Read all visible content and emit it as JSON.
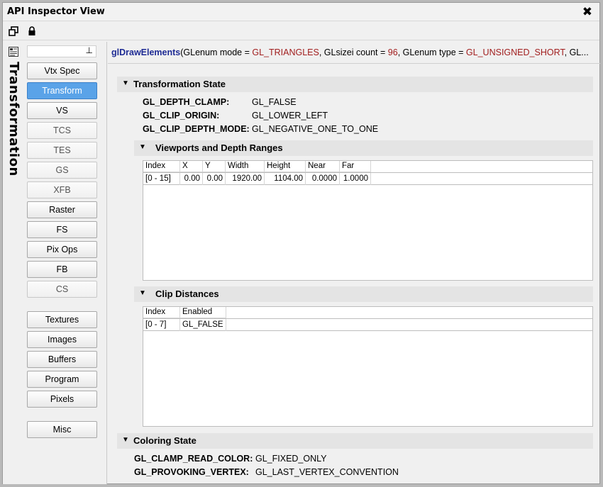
{
  "window": {
    "title": "API Inspector View"
  },
  "sidebar": {
    "vertical_title": "Transformation",
    "search_value": "",
    "stages": [
      {
        "label": "Vtx Spec",
        "state": "normal"
      },
      {
        "label": "Transform",
        "state": "active"
      },
      {
        "label": "VS",
        "state": "normal"
      },
      {
        "label": "TCS",
        "state": "dim"
      },
      {
        "label": "TES",
        "state": "dim"
      },
      {
        "label": "GS",
        "state": "dim"
      },
      {
        "label": "XFB",
        "state": "dim"
      },
      {
        "label": "Raster",
        "state": "normal"
      },
      {
        "label": "FS",
        "state": "normal"
      },
      {
        "label": "Pix Ops",
        "state": "normal"
      },
      {
        "label": "FB",
        "state": "normal"
      },
      {
        "label": "CS",
        "state": "dim"
      }
    ],
    "resources": [
      {
        "label": "Textures"
      },
      {
        "label": "Images"
      },
      {
        "label": "Buffers"
      },
      {
        "label": "Program"
      },
      {
        "label": "Pixels"
      }
    ],
    "misc": {
      "label": "Misc"
    }
  },
  "call": {
    "fn": "glDrawElements",
    "p1": "(GLenum mode = ",
    "v1": "GL_TRIANGLES",
    "p2": ", GLsizei count = ",
    "v2": "96",
    "p3": ", GLenum type = ",
    "v3": "GL_UNSIGNED_SHORT",
    "p4": ", GL..."
  },
  "transformation": {
    "title": "Transformation State",
    "props": [
      {
        "key": "GL_DEPTH_CLAMP:",
        "value": "GL_FALSE"
      },
      {
        "key": "GL_CLIP_ORIGIN:",
        "value": "GL_LOWER_LEFT"
      },
      {
        "key": "GL_CLIP_DEPTH_MODE:",
        "value": "GL_NEGATIVE_ONE_TO_ONE"
      }
    ]
  },
  "viewports": {
    "title": "Viewports and Depth Ranges",
    "columns": [
      "Index",
      "X",
      "Y",
      "Width",
      "Height",
      "Near",
      "Far"
    ],
    "rows": [
      [
        "[0 - 15]",
        "0.00",
        "0.00",
        "1920.00",
        "1104.00",
        "0.0000",
        "1.0000"
      ]
    ]
  },
  "clip": {
    "title": "Clip Distances",
    "columns": [
      "Index",
      "Enabled"
    ],
    "rows": [
      [
        "[0 - 7]",
        "GL_FALSE"
      ]
    ]
  },
  "coloring": {
    "title": "Coloring State",
    "props": [
      {
        "key": "GL_CLAMP_READ_COLOR:",
        "value": "GL_FIXED_ONLY"
      },
      {
        "key": "GL_PROVOKING_VERTEX:",
        "value": "GL_LAST_VERTEX_CONVENTION"
      }
    ]
  },
  "icons": [
    "restore-icon",
    "lock-icon",
    "close-icon",
    "panel-icon",
    "pin-icon",
    "collapse-triangle-icon"
  ]
}
